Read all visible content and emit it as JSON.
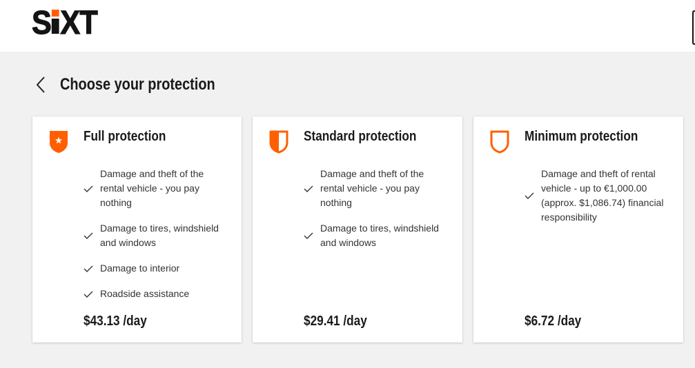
{
  "header": {
    "logo": {
      "text": "SIXT",
      "icon": "sixt-logo"
    }
  },
  "page": {
    "back_icon": "chevron-left-icon",
    "title": "Choose your protection"
  },
  "colors": {
    "accent": "#ff5f00",
    "page_background": "#f1f1f1",
    "card_background": "#ffffff",
    "text": "#1a1a1a"
  },
  "protections": [
    {
      "title": "Full protection",
      "icon": "shield-star-icon",
      "feature_icon": "check-icon",
      "features": [
        "Damage and theft of the rental vehicle - you pay nothing",
        "Damage to tires, windshield and windows",
        "Damage to interior",
        "Roadside assistance"
      ],
      "price": "$43.13 /day"
    },
    {
      "title": "Standard protection",
      "icon": "shield-half-icon",
      "feature_icon": "check-icon",
      "features": [
        "Damage and theft of the rental vehicle - you pay nothing",
        "Damage to tires, windshield and windows"
      ],
      "price": "$29.41 /day"
    },
    {
      "title": "Minimum protection",
      "icon": "shield-outline-icon",
      "feature_icon": "check-icon",
      "features": [
        "Damage and theft of rental vehicle - up to €1,000.00 (approx. $1,086.74) financial responsibility"
      ],
      "price": "$6.72 /day"
    }
  ]
}
